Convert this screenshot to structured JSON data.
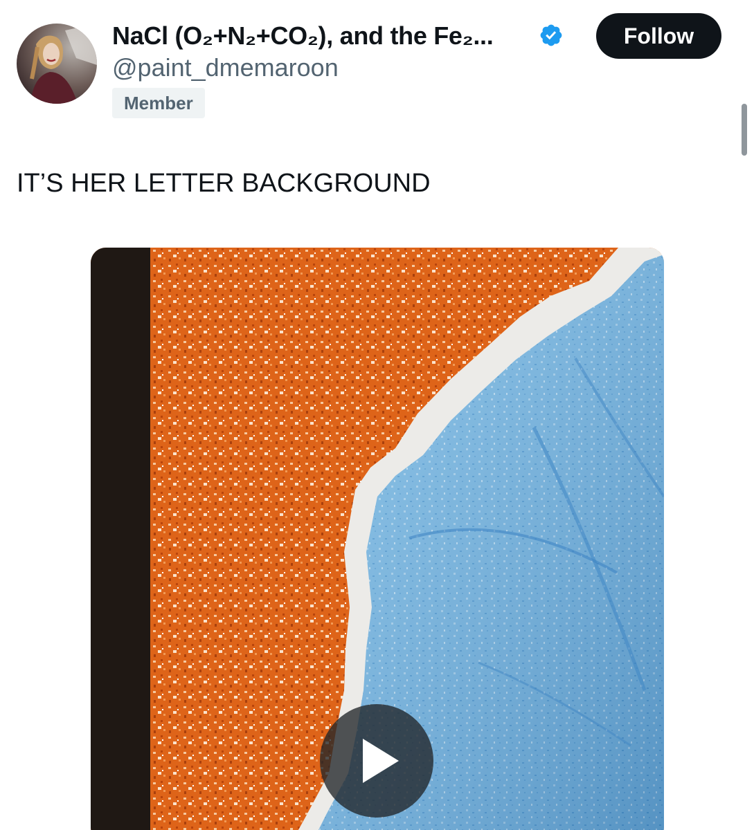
{
  "tweet": {
    "author": {
      "display_name": "NaCl (O₂+N₂+CO₂), and the Fe₂...",
      "handle": "@paint_dmemaroon",
      "badge": "Member",
      "verified": true
    },
    "follow_label": "Follow",
    "text": "IT’S HER LETTER BACKGROUND",
    "media": {
      "kind": "video",
      "play_icon": "play-icon",
      "colors": {
        "glitter_orange": "#e0661c",
        "sky_blue": "#6fb3e0",
        "border_white": "#ecebe8",
        "spine_dark": "#1f1814"
      }
    }
  },
  "colors": {
    "text_primary": "#0f1419",
    "text_secondary": "#536471",
    "verified_blue": "#1d9bf0",
    "badge_bg": "#eff3f4",
    "follow_bg": "#0f1419"
  }
}
